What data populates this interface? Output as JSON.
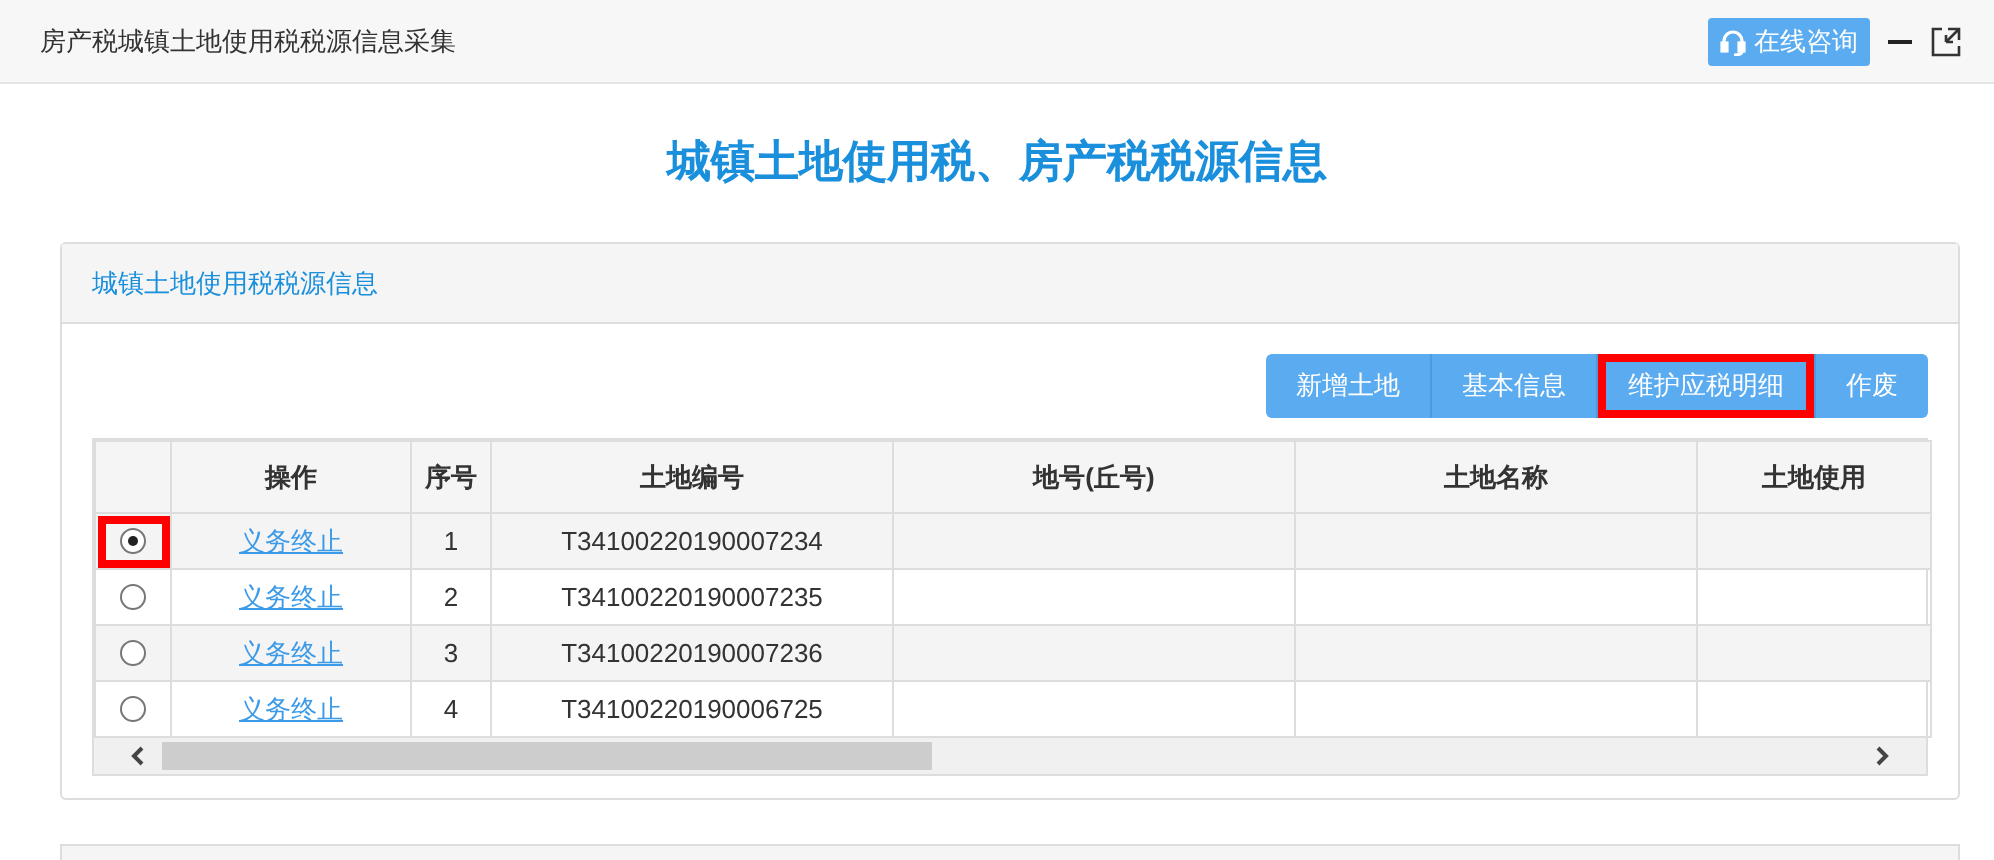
{
  "window": {
    "title": "房产税城镇土地使用税税源信息采集",
    "consult_button": "在线咨询"
  },
  "page_title": "城镇土地使用税、房产税税源信息",
  "panel": {
    "title": "城镇土地使用税税源信息",
    "buttons": [
      {
        "label": "新增土地",
        "highlighted": false
      },
      {
        "label": "基本信息",
        "highlighted": false
      },
      {
        "label": "维护应税明细",
        "highlighted": true
      },
      {
        "label": "作废",
        "highlighted": false
      }
    ],
    "table": {
      "columns": [
        "操作",
        "序号",
        "土地编号",
        "地号(丘号)",
        "土地名称",
        "土地使用"
      ],
      "rows": [
        {
          "selected": true,
          "highlighted": true,
          "action": "义务终止",
          "index": "1",
          "land_code": "T34100220190007234"
        },
        {
          "selected": false,
          "highlighted": false,
          "action": "义务终止",
          "index": "2",
          "land_code": "T34100220190007235"
        },
        {
          "selected": false,
          "highlighted": false,
          "action": "义务终止",
          "index": "3",
          "land_code": "T34100220190007236"
        },
        {
          "selected": false,
          "highlighted": false,
          "action": "义务终止",
          "index": "4",
          "land_code": "T34100220190006725"
        }
      ]
    }
  }
}
